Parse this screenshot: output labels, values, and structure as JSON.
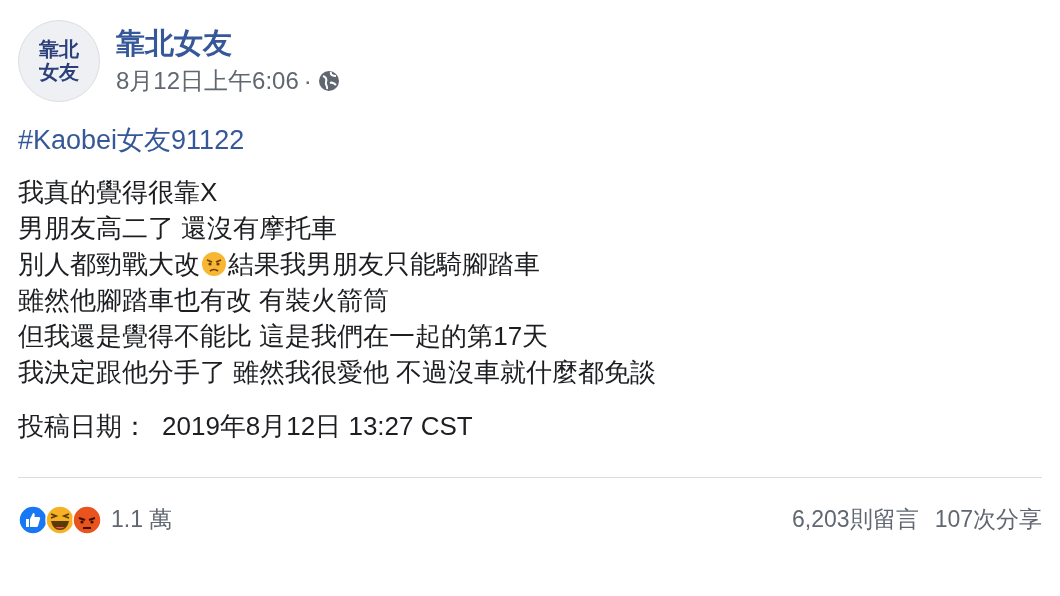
{
  "page": {
    "name": "靠北女友",
    "avatar_lines": [
      "靠北",
      "女友"
    ],
    "timestamp": "8月12日上午6:06",
    "separator": "·"
  },
  "post": {
    "hashtag": "#Kaobei女友91122",
    "lines": [
      [
        {
          "kind": "text",
          "text": "我真的覺得很靠X"
        }
      ],
      [
        {
          "kind": "text",
          "text": "男朋友高二了 還沒有摩托車"
        }
      ],
      [
        {
          "kind": "text",
          "text": "別人都勁戰大改"
        },
        {
          "kind": "emoji"
        },
        {
          "kind": "text",
          "text": "結果我男朋友只能騎腳踏車"
        }
      ],
      [
        {
          "kind": "text",
          "text": "雖然他腳踏車也有改 有裝火箭筒"
        }
      ],
      [
        {
          "kind": "text",
          "text": "但我還是覺得不能比 這是我們在一起的第17天"
        }
      ],
      [
        {
          "kind": "text",
          "text": "我決定跟他分手了 雖然我很愛他 不過沒車就什麼都免談"
        }
      ]
    ],
    "date_label": "投稿日期：",
    "date_value": "2019年8月12日 13:27 CST"
  },
  "footer": {
    "reactions": [
      {
        "kind": "like"
      },
      {
        "kind": "haha"
      },
      {
        "kind": "angry"
      }
    ],
    "reaction_count": "1.1 萬",
    "comments": "6,203則留言",
    "shares": "107次分享"
  }
}
